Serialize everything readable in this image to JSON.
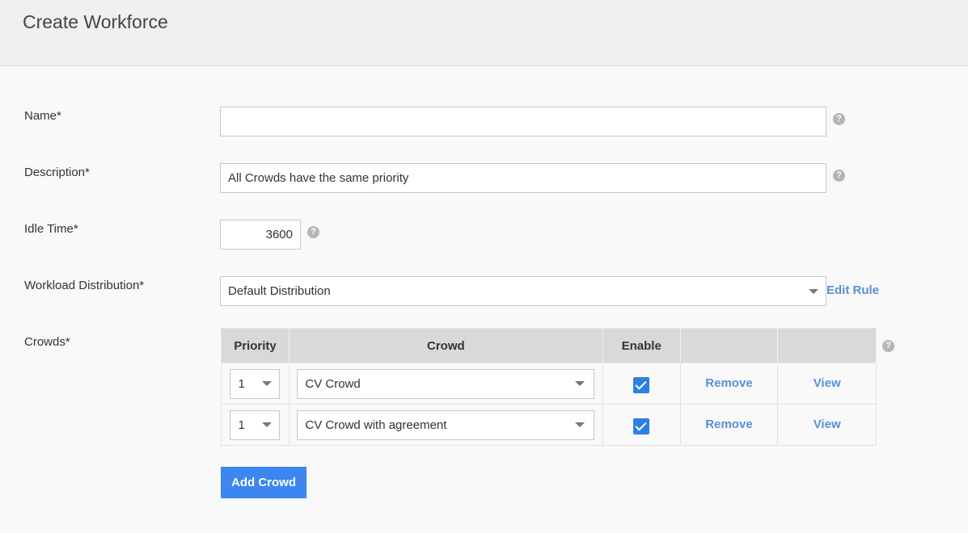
{
  "page": {
    "title": "Create Workforce"
  },
  "form": {
    "name": {
      "label": "Name*",
      "value": "",
      "placeholder": "",
      "help_icon": "question-circle-icon"
    },
    "description": {
      "label": "Description*",
      "value": "All Crowds have the same priority",
      "help_icon": "question-circle-icon"
    },
    "idle_time": {
      "label": "Idle Time*",
      "value": "3600",
      "help_icon": "question-circle-icon"
    },
    "workload": {
      "label": "Workload Distribution*",
      "selected": "Default Distribution",
      "edit_rule": "Edit Rule"
    },
    "crowds": {
      "label": "Crowds*",
      "help_icon": "question-circle-icon",
      "columns": [
        "Priority",
        "Crowd",
        "Enable",
        "",
        ""
      ],
      "rows": [
        {
          "priority": "1",
          "crowd": "CV Crowd",
          "enabled": true,
          "remove": "Remove",
          "view": "View"
        },
        {
          "priority": "1",
          "crowd": "CV Crowd with agreement",
          "enabled": true,
          "remove": "Remove",
          "view": "View"
        }
      ]
    },
    "add_button": "Add Crowd"
  },
  "colors": {
    "accent": "#3b86f0",
    "link": "#5a8fd6",
    "checkbox": "#2d7fe0"
  }
}
